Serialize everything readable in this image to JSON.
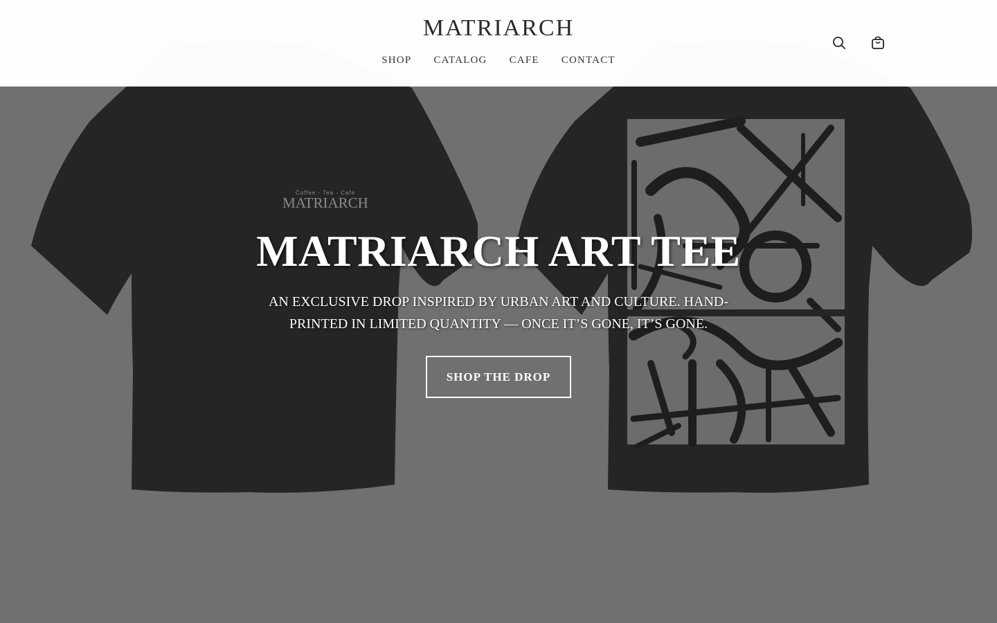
{
  "header": {
    "brand": "MATRIARCH",
    "nav": [
      "SHOP",
      "CATALOG",
      "CAFE",
      "CONTACT"
    ],
    "icons": [
      "search-icon",
      "bag-icon"
    ]
  },
  "hero": {
    "title": "MATRIARCH ART TEE",
    "subtitle": "AN EXCLUSIVE DROP INSPIRED BY URBAN ART AND CULTURE. HAND-PRINTED IN LIMITED QUANTITY — ONCE IT’S GONE, IT’S GONE.",
    "cta_label": "SHOP THE DROP",
    "tee_logo_small": "Coffee  -  Tea  -  Cafe",
    "tee_logo_big": "MATRIARCH"
  },
  "colors": {
    "background": "#707070",
    "shirt": "#252525",
    "header_bg": "#ffffff",
    "text_light": "#ffffff"
  }
}
